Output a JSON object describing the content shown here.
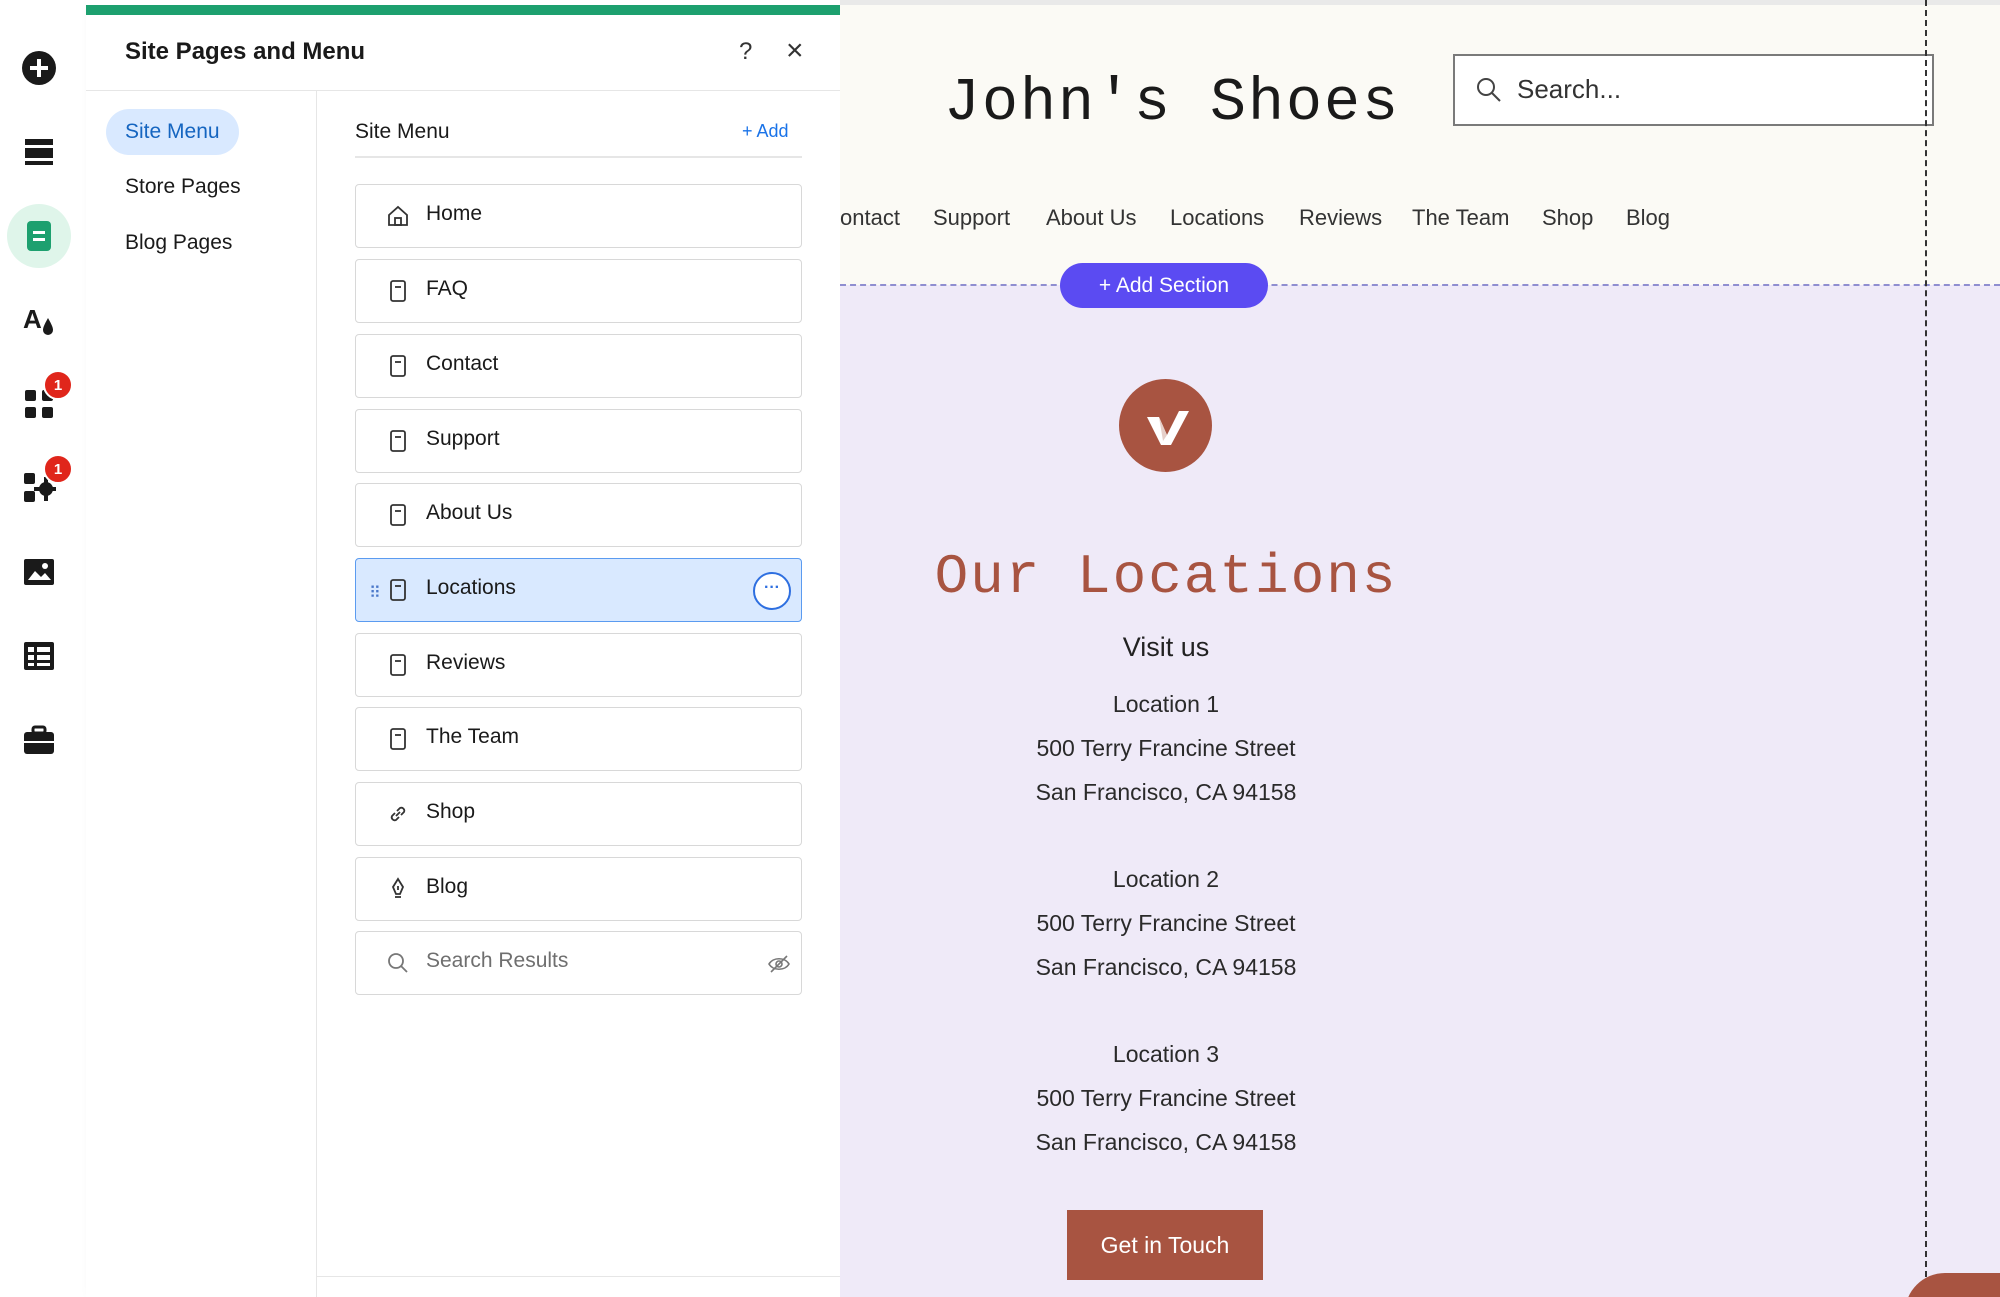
{
  "toolbar": {
    "items": [
      {
        "icon": "plus-circle-icon"
      },
      {
        "icon": "sections-icon"
      },
      {
        "icon": "pages-icon",
        "active": true
      },
      {
        "icon": "design-icon"
      },
      {
        "icon": "apps-icon",
        "badge": "1"
      },
      {
        "icon": "business-apps-icon",
        "badge": "1"
      },
      {
        "icon": "media-icon"
      },
      {
        "icon": "cms-icon"
      },
      {
        "icon": "portfolio-icon"
      }
    ]
  },
  "panel": {
    "title": "Site Pages and Menu",
    "help_label": "?",
    "close_label": "×",
    "nav": [
      "Site Menu",
      "Store Pages",
      "Blog Pages"
    ],
    "list_heading": "Site Menu",
    "add_label": "Add",
    "pages": [
      {
        "label": "Home",
        "icon": "home-icon"
      },
      {
        "label": "FAQ",
        "icon": "page-icon"
      },
      {
        "label": "Contact",
        "icon": "page-icon"
      },
      {
        "label": "Support",
        "icon": "page-icon"
      },
      {
        "label": "About Us",
        "icon": "page-icon"
      },
      {
        "label": "Locations",
        "icon": "page-icon",
        "selected": true
      },
      {
        "label": "Reviews",
        "icon": "page-icon"
      },
      {
        "label": "The Team",
        "icon": "page-icon"
      },
      {
        "label": "Shop",
        "icon": "link-icon"
      },
      {
        "label": "Blog",
        "icon": "pen-icon"
      },
      {
        "label": "Search Results",
        "icon": "search-icon",
        "hidden": true
      }
    ]
  },
  "site": {
    "title": "John's Shoes",
    "search_placeholder": "Search...",
    "nav": [
      "ontact",
      "Support",
      "About Us",
      "Locations",
      "Reviews",
      "The Team",
      "Shop",
      "Blog"
    ],
    "add_section_label": "Add Section",
    "locations_heading": "Our Locations",
    "visit_us": "Visit us",
    "locations": [
      {
        "name": "Location 1",
        "street": "500 Terry Francine Street",
        "city": "San Francisco, CA 94158"
      },
      {
        "name": "Location 2",
        "street": "500 Terry Francine Street",
        "city": "San Francisco, CA 94158"
      },
      {
        "name": "Location 3",
        "street": "500 Terry Francine Street",
        "city": "San Francisco, CA 94158"
      }
    ],
    "cta_label": "Get in Touch"
  },
  "colors": {
    "accent_green": "#1da06f",
    "selected_blue": "#d9e9ff",
    "link_blue": "#1a73e8",
    "brand_rust": "#a85441",
    "add_section_purple": "#5b4bf2",
    "badge_red": "#e0261b"
  }
}
